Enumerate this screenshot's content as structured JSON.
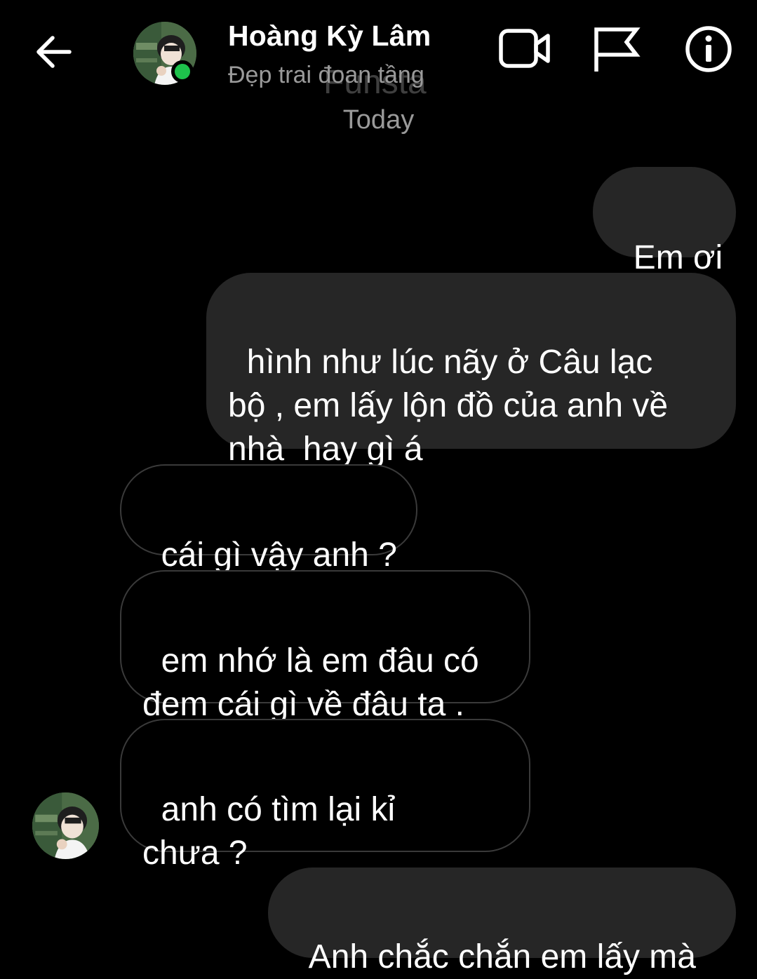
{
  "header": {
    "back_icon": "arrow-left-icon",
    "contact_name": "Hoàng Kỳ Lâm",
    "contact_status": "Đẹp trai đoan tầng",
    "online_color": "#1ec24c",
    "actions": [
      {
        "name": "video-call",
        "icon": "video-camera-icon"
      },
      {
        "name": "report",
        "icon": "flag-icon"
      },
      {
        "name": "info",
        "icon": "info-circle-icon"
      }
    ]
  },
  "watermark": "Funsta",
  "date_separator": "Today",
  "messages": [
    {
      "direction": "outgoing",
      "text": "Em ơi"
    },
    {
      "direction": "outgoing",
      "text": "hình như lúc nãy ở Câu lạc\nbộ , em lấy lộn đồ của anh về\nnhà  hay gì á"
    },
    {
      "direction": "incoming",
      "text": "cái gì vậy anh ?"
    },
    {
      "direction": "incoming",
      "text": "em nhớ là em đâu có\nđem cái gì về đâu ta ."
    },
    {
      "direction": "incoming",
      "text": "anh có tìm lại kỉ\nchưa ?"
    },
    {
      "direction": "outgoing",
      "text": "Anh chắc chắn em lấy mà"
    }
  ],
  "colors": {
    "background": "#000000",
    "outgoing_bubble": "#262626",
    "incoming_border": "#3a3a3a",
    "secondary_text": "#9a9a9a"
  }
}
